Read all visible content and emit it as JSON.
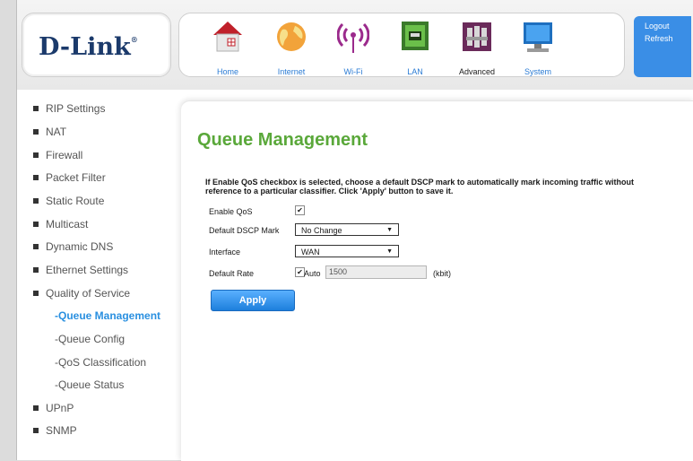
{
  "brand": {
    "logo_text": "D-Link",
    "reg_mark": "®"
  },
  "nav": {
    "items": [
      {
        "label": "Home",
        "icon": "home-icon"
      },
      {
        "label": "Internet",
        "icon": "globe-icon"
      },
      {
        "label": "Wi-Fi",
        "icon": "wifi-icon"
      },
      {
        "label": "LAN",
        "icon": "lan-icon"
      },
      {
        "label": "Advanced",
        "icon": "tools-icon"
      },
      {
        "label": "System",
        "icon": "monitor-icon"
      }
    ],
    "active": "Advanced"
  },
  "session": {
    "logout_label": "Logout",
    "refresh_label": "Refresh"
  },
  "sidebar": {
    "items": [
      {
        "label": "RIP Settings"
      },
      {
        "label": "NAT"
      },
      {
        "label": "Firewall"
      },
      {
        "label": "Packet Filter"
      },
      {
        "label": "Static Route"
      },
      {
        "label": "Multicast"
      },
      {
        "label": "Dynamic DNS"
      },
      {
        "label": "Ethernet Settings"
      },
      {
        "label": "Quality of Service"
      }
    ],
    "subitems": [
      {
        "label": "-Queue Management"
      },
      {
        "label": "-Queue Config"
      },
      {
        "label": "-QoS Classification"
      },
      {
        "label": "-Queue Status"
      }
    ],
    "items_after": [
      {
        "label": "UPnP"
      },
      {
        "label": "SNMP"
      }
    ]
  },
  "page": {
    "title": "Queue Management",
    "description": "If Enable QoS checkbox is selected, choose a default DSCP mark to automatically mark incoming traffic without reference to a particular classifier. Click 'Apply' button to save it."
  },
  "form": {
    "enable_qos": {
      "label": "Enable QoS",
      "checked": true
    },
    "dscp": {
      "label": "Default DSCP Mark",
      "value": "No Change"
    },
    "interface": {
      "label": "Interface",
      "value": "WAN"
    },
    "rate": {
      "label": "Default Rate",
      "auto_label": "Auto",
      "auto_checked": true,
      "value": "1500",
      "unit": "(kbit)"
    },
    "apply_label": "Apply"
  },
  "colors": {
    "accent_blue": "#2a90e0",
    "title_green": "#5aa83a",
    "logo_navy": "#1b3a6b"
  }
}
